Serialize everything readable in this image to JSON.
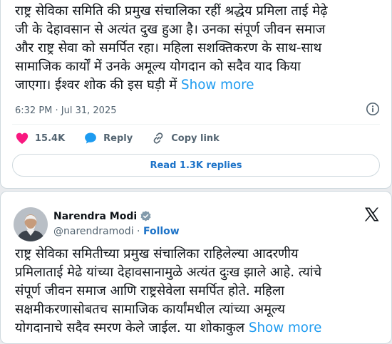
{
  "tweet1": {
    "lines": [
      "राष्ट्र सेविका समिति की प्रमुख संचालिका रहीं श्रद्धेय प्रमिला ताई मेढ़े",
      "जी के देहावसान से अत्यंत दुख हुआ है। उनका संपूर्ण जीवन समाज",
      "और राष्ट्र सेवा को समर्पित रहा। महिला सशक्तिकरण के साथ-साथ",
      "सामाजिक कार्यों में उनके अमूल्य योगदान को सदैव याद किया",
      "जाएगा। ईश्वर शोक की इस घड़ी में"
    ],
    "show_more": "Show more",
    "timestamp": "6:32 PM · Jul 31, 2025",
    "likes": "15.4K",
    "reply_label": "Reply",
    "copy_link_label": "Copy link",
    "read_replies": "Read 1.3K replies"
  },
  "tweet2": {
    "author_name": "Narendra Modi",
    "handle": "@narendramodi",
    "separator": "·",
    "follow_label": "Follow",
    "lines": [
      "राष्ट्र सेविका समितीच्या प्रमुख संचालिका राहिलेल्या आदरणीय",
      "प्रमिलाताई मेढे यांच्या देहावसानामुळे अत्यंत दुःख झाले आहे. त्यांचे",
      "संपूर्ण जीवन समाज आणि राष्ट्रसेवेला समर्पित होते. महिला",
      "सक्षमीकरणासोबतच सामाजिक कार्यांमधील त्यांच्या  अमूल्य",
      "योगदानाचे सदैव  स्मरण केले जाईल. या शोकाकुल"
    ],
    "show_more": "Show more"
  },
  "colors": {
    "accent": "#1d9bf0",
    "like": "#f91880",
    "text": "#0f1419",
    "muted": "#536471"
  },
  "icons": [
    "info-icon",
    "heart-icon",
    "reply-bubble-icon",
    "link-icon",
    "verified-badge-icon",
    "x-logo-icon"
  ]
}
